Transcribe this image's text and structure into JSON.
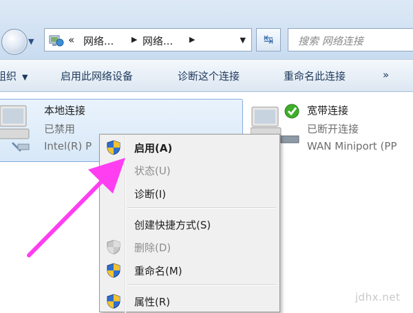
{
  "address": {
    "breadcrumb_prefix": "«",
    "crumbs": [
      "网络...",
      "网络..."
    ],
    "search_placeholder": "搜索 网络连接"
  },
  "toolbar": {
    "organize": "组织",
    "enable_device": "启用此网络设备",
    "diagnose": "诊断这个连接",
    "rename": "重命名此连接",
    "more": "»"
  },
  "connections": [
    {
      "name": "本地连接",
      "status": "已禁用",
      "device": "Intel(R) P"
    },
    {
      "name": "宽带连接",
      "status": "已断开连接",
      "device": "WAN Miniport (PP"
    }
  ],
  "context_menu": {
    "items": [
      {
        "label": "启用(A)",
        "bold": true,
        "disabled": false,
        "icon": "uac-shield-icon"
      },
      {
        "label": "状态(U)",
        "bold": false,
        "disabled": true,
        "icon": ""
      },
      {
        "label": "诊断(I)",
        "bold": false,
        "disabled": false,
        "icon": ""
      },
      {
        "label": "创建快捷方式(S)",
        "bold": false,
        "disabled": false,
        "icon": ""
      },
      {
        "label": "删除(D)",
        "bold": false,
        "disabled": true,
        "icon": "uac-shield-icon"
      },
      {
        "label": "重命名(M)",
        "bold": false,
        "disabled": false,
        "icon": "uac-shield-icon"
      },
      {
        "label": "属性(R)",
        "bold": false,
        "disabled": false,
        "icon": "uac-shield-icon"
      }
    ]
  },
  "watermark": "jdhx.net",
  "colors": {
    "annotation_arrow": "#ff3ef2",
    "selection_border": "#84acdd",
    "status_ok": "#3fae2a"
  }
}
